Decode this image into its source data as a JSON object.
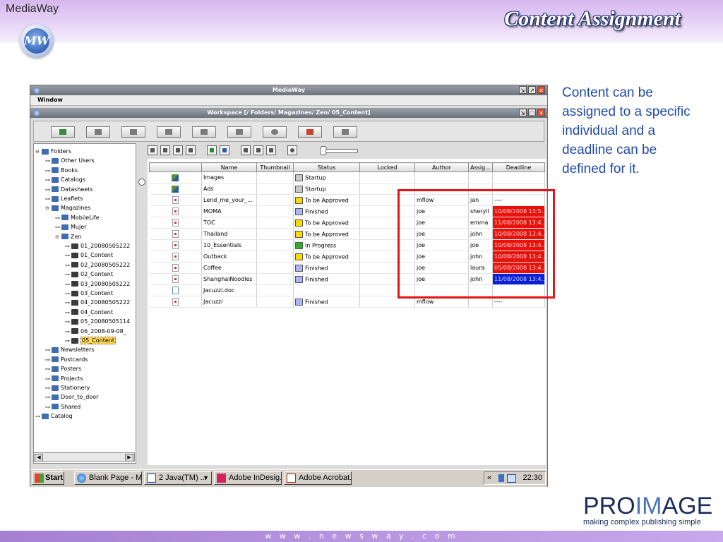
{
  "slide": {
    "brand": "MediaWay",
    "logo_text": "MW",
    "title": "Content Assignment",
    "description": "Content can be assigned to a specific individual and a deadline can be defined for it.",
    "footer_url": "w w w . n e w s w a y . c o m",
    "proimage": {
      "pro": "PRO",
      "im": "IM",
      "age": "AGE",
      "tagline": "making complex publishing simple"
    }
  },
  "app": {
    "title": "MediaWay",
    "menu": [
      "Window"
    ],
    "workspace_title": "Workspace [/ Folders/ Magazines/ Zen/ 05_Content]",
    "tree": [
      {
        "label": "Folders",
        "level": 0,
        "toggle": "⊖"
      },
      {
        "label": "Other Users",
        "level": 1,
        "toggle": "⊶"
      },
      {
        "label": "Books",
        "level": 1,
        "toggle": "⊶"
      },
      {
        "label": "Catalogs",
        "level": 1,
        "toggle": "⊶"
      },
      {
        "label": "Datasheets",
        "level": 1,
        "toggle": "⊶"
      },
      {
        "label": "Leaflets",
        "level": 1,
        "toggle": "⊶"
      },
      {
        "label": "Magazines",
        "level": 1,
        "toggle": "⊖"
      },
      {
        "label": "MobileLife",
        "level": 2,
        "toggle": "⊶"
      },
      {
        "label": "Mujer",
        "level": 2,
        "toggle": "⊶"
      },
      {
        "label": "Zen",
        "level": 2,
        "toggle": "⊖"
      },
      {
        "label": "01_20080505222",
        "level": 3,
        "toggle": "⊶"
      },
      {
        "label": "01_Content",
        "level": 3,
        "toggle": "⊶"
      },
      {
        "label": "02_20080505222",
        "level": 3,
        "toggle": "⊶"
      },
      {
        "label": "02_Content",
        "level": 3,
        "toggle": "⊶"
      },
      {
        "label": "03_20080505222",
        "level": 3,
        "toggle": "⊶"
      },
      {
        "label": "03_Content",
        "level": 3,
        "toggle": "⊶"
      },
      {
        "label": "04_20080505222",
        "level": 3,
        "toggle": "⊶"
      },
      {
        "label": "04_Content",
        "level": 3,
        "toggle": "⊶"
      },
      {
        "label": "05_20080505114",
        "level": 3,
        "toggle": "⊶"
      },
      {
        "label": "06_2008-09-08_",
        "level": 3,
        "toggle": "⊶"
      },
      {
        "label": "05_Content",
        "level": 3,
        "toggle": "⊶",
        "selected": true
      },
      {
        "label": "Newsletters",
        "level": 1,
        "toggle": "⊶"
      },
      {
        "label": "Postcards",
        "level": 1,
        "toggle": "⊶"
      },
      {
        "label": "Posters",
        "level": 1,
        "toggle": "⊶"
      },
      {
        "label": "Projects",
        "level": 1,
        "toggle": "⊶"
      },
      {
        "label": "Stationery",
        "level": 1,
        "toggle": "⊶"
      },
      {
        "label": "Door_to_door",
        "level": 1,
        "toggle": "⊶"
      },
      {
        "label": "Shared",
        "level": 1,
        "toggle": "⊶"
      },
      {
        "label": "Catalog",
        "level": 0,
        "toggle": "⊶"
      }
    ],
    "columns": [
      "Name",
      "Thumbnail",
      "Status",
      "Locked",
      "Author",
      "Assig...",
      "Deadline"
    ],
    "rows": [
      {
        "type": "folder",
        "name": "Images",
        "status": "Startup",
        "status_color": "#c8c8c8",
        "author": "",
        "assignee": "",
        "deadline": "",
        "deadline_style": ""
      },
      {
        "type": "folder",
        "name": "Ads",
        "status": "Startup",
        "status_color": "#c8c8c8",
        "author": "",
        "assignee": "",
        "deadline": "",
        "deadline_style": ""
      },
      {
        "type": "file",
        "name": "Lend_me_your_...",
        "status": "To be Approved",
        "status_color": "#ffd800",
        "author": "mflow",
        "assignee": "jan",
        "deadline": "----",
        "deadline_style": ""
      },
      {
        "type": "file",
        "name": "MOMA",
        "status": "Finished",
        "status_color": "#aab4ff",
        "author": "joe",
        "assignee": "sheryll",
        "deadline": "10/08/2008 13:5...",
        "deadline_style": "red"
      },
      {
        "type": "file",
        "name": "TOC",
        "status": "To be Approved",
        "status_color": "#ffd800",
        "author": "joe",
        "assignee": "emma",
        "deadline": "11/08/2008 13:4...",
        "deadline_style": "red"
      },
      {
        "type": "file",
        "name": "Thailand",
        "status": "To be Approved",
        "status_color": "#ffd800",
        "author": "joe",
        "assignee": "john",
        "deadline": "10/08/2008 13:4...",
        "deadline_style": "red"
      },
      {
        "type": "file",
        "name": "10_Essentials",
        "status": "In Progress",
        "status_color": "#2ab02a",
        "author": "joe",
        "assignee": "joe",
        "deadline": "10/08/2008 13:4...",
        "deadline_style": "red"
      },
      {
        "type": "file",
        "name": "Outback",
        "status": "To be Approved",
        "status_color": "#ffd800",
        "author": "joe",
        "assignee": "john",
        "deadline": "10/08/2008 13:4...",
        "deadline_style": "red"
      },
      {
        "type": "file",
        "name": "Coffee",
        "status": "Finished",
        "status_color": "#aab4ff",
        "author": "joe",
        "assignee": "laura",
        "deadline": "05/08/2008 13:4...",
        "deadline_style": "red"
      },
      {
        "type": "file",
        "name": "ShanghaiNoodles",
        "status": "Finished",
        "status_color": "#aab4ff",
        "author": "joe",
        "assignee": "john",
        "deadline": "11/08/2008 13:4...",
        "deadline_style": "blue"
      },
      {
        "type": "doc",
        "name": "Jacuzzi.doc",
        "status": "",
        "status_color": "",
        "author": "",
        "assignee": "",
        "deadline": "",
        "deadline_style": ""
      },
      {
        "type": "file",
        "name": "Jacuzzi",
        "status": "Finished",
        "status_color": "#aab4ff",
        "author": "mflow",
        "assignee": "",
        "deadline": "----",
        "deadline_style": ""
      }
    ]
  },
  "taskbar": {
    "start": "Start",
    "items": [
      "Blank Page - Mi...",
      "2 Java(TM) ...",
      "Adobe InDesig...",
      "Adobe Acrobat..."
    ],
    "chevron": "«",
    "clock": "22:30"
  },
  "colors": {
    "highlight_box": "#e4141b",
    "title_text": "#1b2d6b",
    "desc_text": "#1f4aa8"
  }
}
